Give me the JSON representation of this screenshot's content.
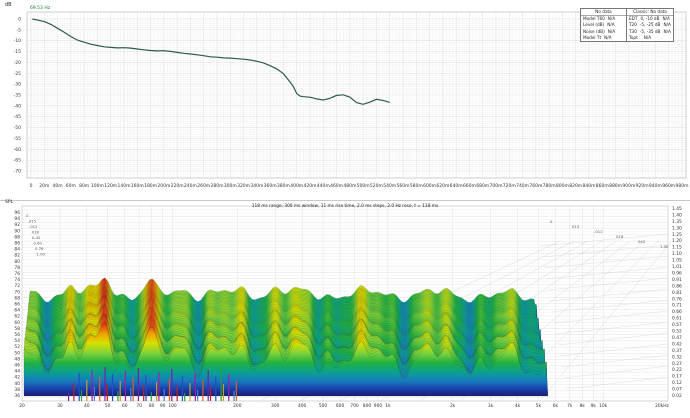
{
  "top": {
    "units": "dB",
    "cursor_readout": "69.53 Hz",
    "y_ticks": [
      "0",
      "-5",
      "-10",
      "-15",
      "-20",
      "-25",
      "-30",
      "-35",
      "-40",
      "-45",
      "-50",
      "-55",
      "-60",
      "-65",
      "-70"
    ],
    "x_ticks": [
      "0",
      "20m",
      "40m",
      "60m",
      "80m",
      "100m",
      "120m",
      "140m",
      "160m",
      "180m",
      "200m",
      "220m",
      "240m",
      "260m",
      "280m",
      "300m",
      "320m",
      "340m",
      "360m",
      "380m",
      "400m",
      "420m",
      "440m",
      "460m",
      "480m",
      "500m",
      "520m",
      "540m",
      "560m",
      "580m",
      "600m",
      "620m",
      "640m",
      "660m",
      "680m",
      "700m",
      "720m",
      "740m",
      "760m",
      "780m",
      "800m",
      "820m",
      "840m",
      "860m",
      "880m",
      "900m",
      "920m",
      "940m",
      "960m",
      "980m"
    ],
    "trace_color": "#2d5a50",
    "decay_trace": [
      [
        2,
        0
      ],
      [
        10,
        -0.5
      ],
      [
        20,
        -1.2
      ],
      [
        30,
        -2.5
      ],
      [
        40,
        -4.3
      ],
      [
        50,
        -6.1
      ],
      [
        60,
        -8.1
      ],
      [
        70,
        -9.7
      ],
      [
        80,
        -10.7
      ],
      [
        90,
        -11.6
      ],
      [
        100,
        -12.2
      ],
      [
        110,
        -12.8
      ],
      [
        120,
        -13.1
      ],
      [
        130,
        -13.3
      ],
      [
        140,
        -13.2
      ],
      [
        150,
        -13.4
      ],
      [
        160,
        -13.8
      ],
      [
        170,
        -14.2
      ],
      [
        180,
        -14.5
      ],
      [
        190,
        -14.7
      ],
      [
        200,
        -14.6
      ],
      [
        210,
        -14.9
      ],
      [
        220,
        -15.4
      ],
      [
        230,
        -15.8
      ],
      [
        240,
        -16.1
      ],
      [
        250,
        -16.5
      ],
      [
        260,
        -16.9
      ],
      [
        270,
        -17.4
      ],
      [
        280,
        -17.6
      ],
      [
        290,
        -17.9
      ],
      [
        300,
        -18.0
      ],
      [
        310,
        -18.3
      ],
      [
        320,
        -18.5
      ],
      [
        330,
        -18.9
      ],
      [
        340,
        -19.5
      ],
      [
        350,
        -20.2
      ],
      [
        360,
        -21.5
      ],
      [
        370,
        -23.0
      ],
      [
        380,
        -25.2
      ],
      [
        390,
        -29.0
      ],
      [
        395,
        -31.2
      ],
      [
        400,
        -34.3
      ],
      [
        405,
        -35.5
      ],
      [
        410,
        -35.8
      ],
      [
        420,
        -36.0
      ],
      [
        430,
        -36.8
      ],
      [
        440,
        -37.3
      ],
      [
        450,
        -36.5
      ],
      [
        460,
        -35.2
      ],
      [
        470,
        -34.9
      ],
      [
        480,
        -36.0
      ],
      [
        490,
        -38.5
      ],
      [
        500,
        -39.3
      ],
      [
        510,
        -38.3
      ],
      [
        520,
        -37.0
      ],
      [
        530,
        -37.5
      ],
      [
        540,
        -38.4
      ]
    ],
    "left_table": {
      "header": "No data",
      "rows": [
        [
          "Model T60",
          "N/A"
        ],
        [
          "Level (dB)",
          "N/A"
        ],
        [
          "Noise (dB)",
          "N/A"
        ],
        [
          "Model Tt",
          "N/A"
        ]
      ]
    },
    "right_table": {
      "header": "Classic: No data",
      "rows": [
        [
          "EDT",
          "0, -10 dB",
          "N/A"
        ],
        [
          "T20",
          "-5, -25 dB",
          "N/A"
        ],
        [
          "T30",
          "-5, -35 dB",
          "N/A"
        ],
        [
          "Topt",
          "",
          "N/A"
        ]
      ]
    }
  },
  "waterfall": {
    "units": "SPL",
    "info": "118 ms range, 300 ms window, 11 ms rise time, 2.0 ms steps, 2.0 Hz reso, t = 118 ms",
    "y_left_ticks": [
      "96",
      "94",
      "92",
      "90",
      "88",
      "86",
      "84",
      "82",
      "80",
      "78",
      "76",
      "74",
      "72",
      "70",
      "68",
      "66",
      "64",
      "62",
      "60",
      "58",
      "56",
      "54",
      "52",
      "50",
      "48",
      "46",
      "44",
      "42",
      "40",
      "38",
      "36"
    ],
    "y_right_ticks": [
      "1.45",
      "1.40",
      "1.35",
      "1.30",
      "1.25",
      "1.20",
      "1.15",
      "1.10",
      "1.05",
      "1.01",
      "0.96",
      "0.91",
      "0.86",
      "0.81",
      "0.76",
      "0.71",
      "0.66",
      "0.61",
      "0.57",
      "0.52",
      "0.47",
      "0.42",
      "0.37",
      "0.32",
      "0.27",
      "0.22",
      "0.17",
      "0.12",
      "0.07",
      "0.02"
    ],
    "x_ticks": [
      "20",
      "30",
      "40",
      "50",
      "60",
      "70",
      "80",
      "90",
      "100",
      "200",
      "300",
      "400",
      "500",
      "600",
      "700",
      "800",
      "900",
      "1k",
      "2k",
      "3k",
      "4k",
      "5k",
      "6k",
      "7k",
      "8k",
      "9k",
      "10k",
      "20kHz"
    ],
    "depth_labels": [
      "0",
      ".015",
      ".012",
      ".018",
      "0.42",
      "0.60",
      "0.76",
      "1.00"
    ],
    "right_depth_labels": [
      "0",
      "015",
      "-012",
      "018",
      "042",
      "1.00"
    ]
  }
}
